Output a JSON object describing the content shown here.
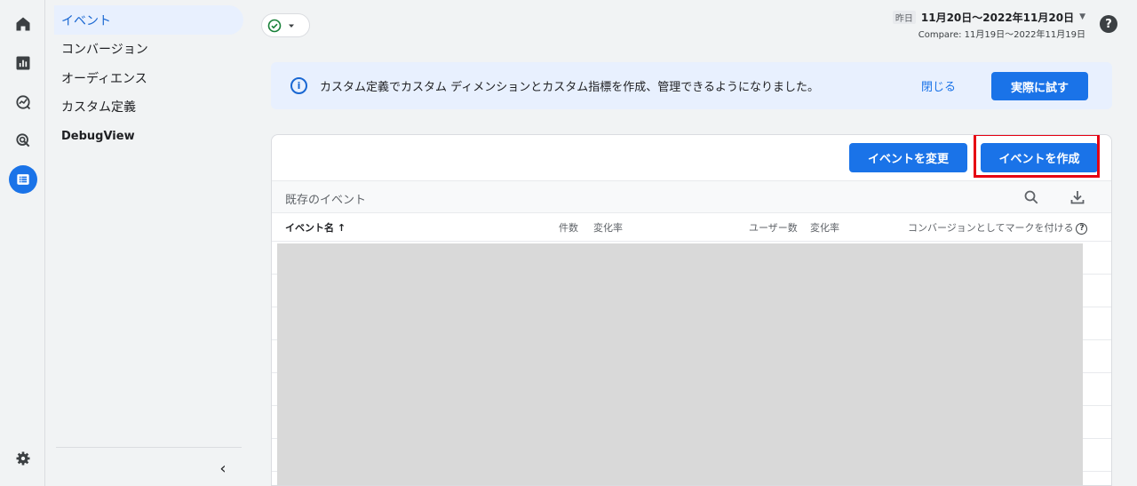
{
  "rail": {
    "items": [
      {
        "icon": "home-icon"
      },
      {
        "icon": "reports-icon"
      },
      {
        "icon": "explore-icon"
      },
      {
        "icon": "advertising-icon"
      },
      {
        "icon": "configure-icon"
      }
    ],
    "settings_icon": "gear-icon"
  },
  "subnav": {
    "items": [
      {
        "label": "イベント",
        "active": true
      },
      {
        "label": "コンバージョン"
      },
      {
        "label": "オーディエンス"
      },
      {
        "label": "カスタム定義"
      },
      {
        "label": "DebugView"
      }
    ],
    "collapse_glyph": "‹"
  },
  "header": {
    "date_prefix": "昨日",
    "date_range": "11月20日～2022年11月20日",
    "compare": "Compare: 11月19日～2022年11月19日",
    "help_glyph": "?"
  },
  "banner": {
    "text": "カスタム定義でカスタム ディメンションとカスタム指標を作成、管理できるようになりました。",
    "close_label": "閉じる",
    "try_label": "実際に試す"
  },
  "card": {
    "modify_button": "イベントを変更",
    "create_button": "イベントを作成",
    "subtitle": "既存のイベント",
    "columns": {
      "event_name": "イベント名 ↑",
      "count": "件数",
      "count_change": "変化率",
      "users": "ユーザー数",
      "users_change": "変化率",
      "mark_conversion": "コンバージョンとしてマークを付ける"
    }
  },
  "colors": {
    "accent": "#1a73e8",
    "highlight": "#e60012",
    "status_ok": "#188038"
  }
}
